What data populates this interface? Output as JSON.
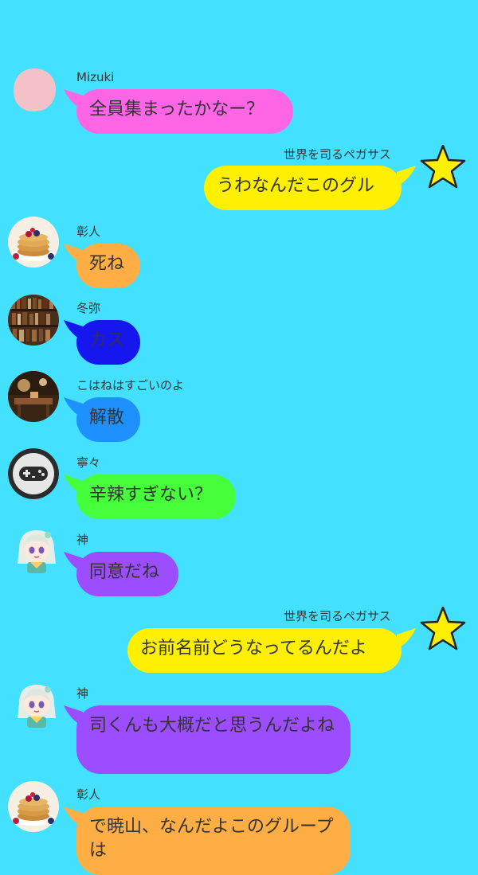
{
  "messages": [
    {
      "name": "Mizuki",
      "text": "全員集まったかなー？",
      "avatar": "pink-blob-icon",
      "color": "#ff66e6",
      "side": "left"
    },
    {
      "name": "世界を司るペガサス",
      "text": "うわなんだこのグル",
      "avatar": "star-icon",
      "color": "#ffef00",
      "side": "right"
    },
    {
      "name": "彰人",
      "text": "死ね",
      "avatar": "pancake-photo",
      "color": "#ffae45",
      "side": "left"
    },
    {
      "name": "冬弥",
      "text": "カス",
      "avatar": "bookshelf-photo",
      "color": "#1616ef",
      "side": "left"
    },
    {
      "name": "こはねはすごいのよ",
      "text": "解散",
      "avatar": "cafe-interior-photo",
      "color": "#1e90ff",
      "side": "left"
    },
    {
      "name": "寧々",
      "text": "辛辣すぎない？",
      "avatar": "gamepad-icon",
      "color": "#44ff3a",
      "side": "left"
    },
    {
      "name": "神",
      "text": "同意だね",
      "avatar": "anime-girl-avatar",
      "color": "#9b4dff",
      "side": "left"
    },
    {
      "name": "世界を司るペガサス",
      "text": "お前名前どうなってるんだよ",
      "avatar": "star-icon",
      "color": "#ffef00",
      "side": "right"
    },
    {
      "name": "神",
      "text": "司くんも大概だと思うんだよね",
      "avatar": "anime-girl-avatar",
      "color": "#9b4dff",
      "side": "left"
    },
    {
      "name": "彰人",
      "text": "で暁山、なんだよこのグループは",
      "avatar": "pancake-photo",
      "color": "#ffae45",
      "side": "left"
    }
  ]
}
